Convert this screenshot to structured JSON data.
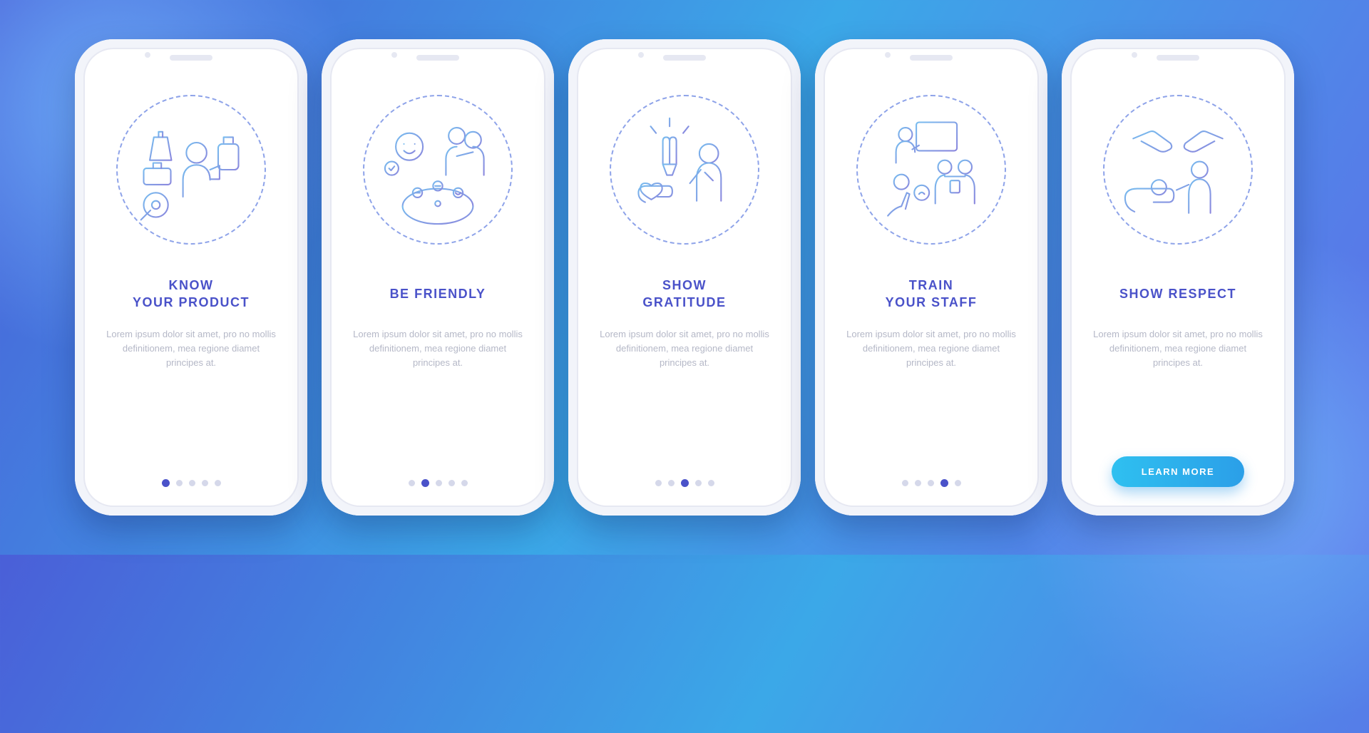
{
  "stage": {
    "screens": [
      {
        "title": "KNOW\nYOUR PRODUCT",
        "body": "Lorem ipsum dolor sit amet, pro no mollis definitionem, mea regione diamet principes at.",
        "activeDot": 0,
        "icon": "know-product"
      },
      {
        "title": "BE FRIENDLY",
        "body": "Lorem ipsum dolor sit amet, pro no mollis definitionem, mea regione diamet principes at.",
        "activeDot": 1,
        "icon": "be-friendly"
      },
      {
        "title": "SHOW\nGRATITUDE",
        "body": "Lorem ipsum dolor sit amet, pro no mollis definitionem, mea regione diamet principes at.",
        "activeDot": 2,
        "icon": "show-gratitude"
      },
      {
        "title": "TRAIN\nYOUR STAFF",
        "body": "Lorem ipsum dolor sit amet, pro no mollis definitionem, mea regione diamet principes at.",
        "activeDot": 3,
        "icon": "train-staff"
      },
      {
        "title": "SHOW RESPECT",
        "body": "Lorem ipsum dolor sit amet, pro no mollis definitionem, mea regione diamet principes at.",
        "icon": "show-respect",
        "cta": "LEARN MORE"
      }
    ],
    "totalScreens": 5,
    "colors": {
      "heading": "#4a52c9",
      "body": "#b5b8c7",
      "accent": "#2fc0f0"
    }
  }
}
